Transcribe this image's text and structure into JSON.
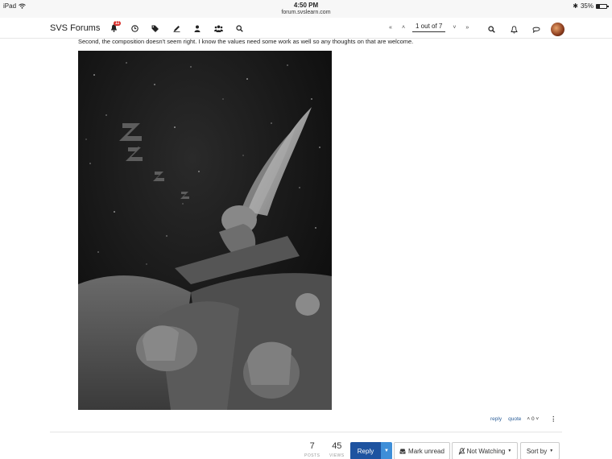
{
  "statusbar": {
    "device": "iPad",
    "time": "4:50 PM",
    "url": "forum.svslearn.com",
    "battery": "35%"
  },
  "nav": {
    "brand": "SVS Forums",
    "notification_count": "11",
    "icons": [
      "notification-icon",
      "clock-icon",
      "tags-icon",
      "pencil-icon",
      "user-icon",
      "users-icon",
      "search-icon"
    ],
    "pager": {
      "label": "1 out of 7"
    }
  },
  "post": {
    "text": "Second, the composition doesn't seem right. I know the values need some work as well so any thoughts on that are welcome.",
    "reply_label": "reply",
    "quote_label": "quote",
    "vote_count": "0"
  },
  "topic": {
    "posts_count": "7",
    "posts_label": "POSTS",
    "views_count": "45",
    "views_label": "VIEWS",
    "reply_label": "Reply",
    "mark_unread_label": "Mark unread",
    "watching_label": "Not Watching",
    "sort_label": "Sort by"
  },
  "colors": {
    "primary": "#1e53a0",
    "primary_caret": "#3e8ed8",
    "badge": "#d9302c",
    "link": "#2c5f99"
  }
}
